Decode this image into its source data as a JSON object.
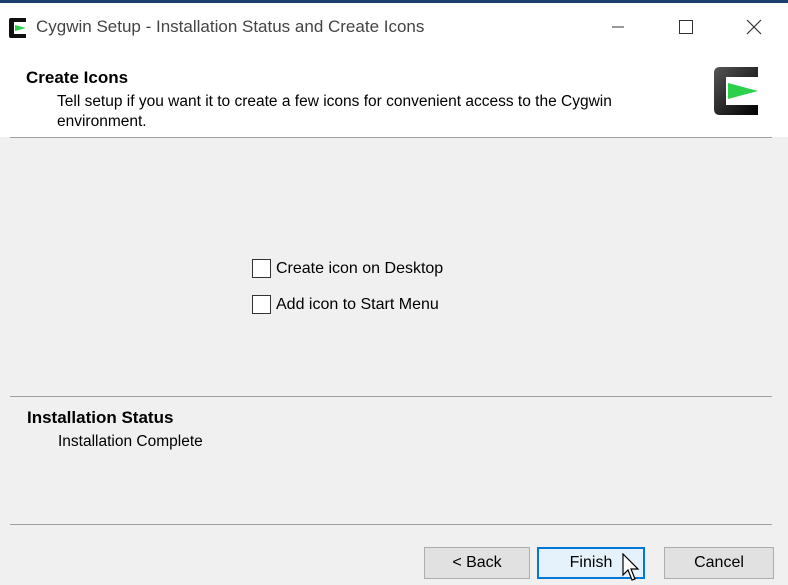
{
  "window": {
    "title": "Cygwin Setup - Installation Status and Create Icons",
    "app_icon": "cygwin-logo-icon",
    "controls": [
      "minimize-icon",
      "maximize-icon",
      "close-icon"
    ]
  },
  "header": {
    "title": "Create Icons",
    "subtitle": "Tell setup if you want it to create a few icons for convenient access to the Cygwin environment.",
    "logo": "cygwin-logo-icon"
  },
  "options": {
    "desktop": {
      "label": "Create icon on Desktop",
      "checked": false
    },
    "start_menu": {
      "label": "Add icon to Start Menu",
      "checked": false
    }
  },
  "status": {
    "title": "Installation Status",
    "value": "Installation Complete"
  },
  "buttons": {
    "back": "< Back",
    "finish": "Finish",
    "cancel": "Cancel"
  },
  "colors": {
    "titlebar_border": "#1b3e6e",
    "focus_accent": "#0078d7",
    "logo_green": "#2bd14a"
  }
}
